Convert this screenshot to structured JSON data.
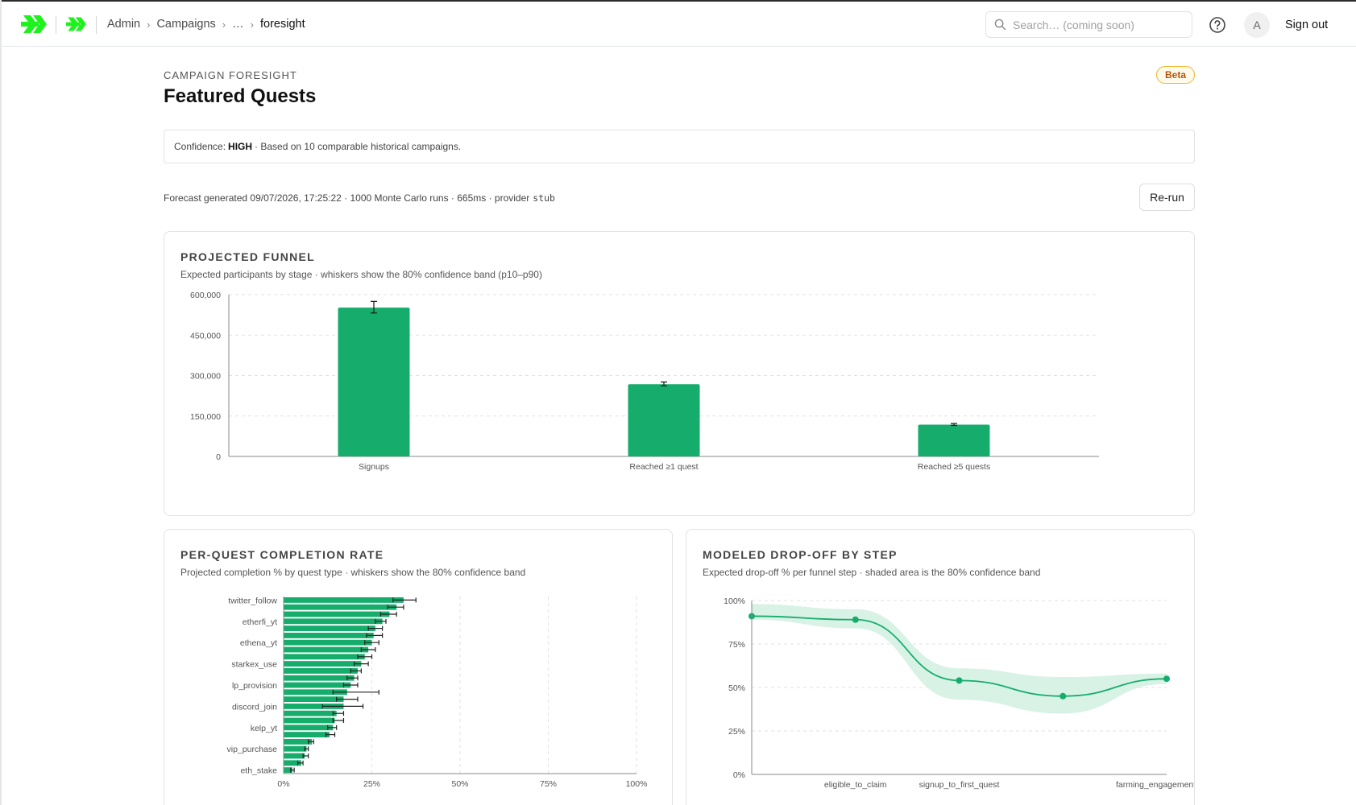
{
  "header": {
    "breadcrumb": [
      "Admin",
      "Campaigns",
      "…",
      "foresight"
    ],
    "search_placeholder": "Search… (coming soon)",
    "avatar_initial": "A",
    "sign_out": "Sign out"
  },
  "page": {
    "eyebrow": "CAMPAIGN FORESIGHT",
    "title": "Featured Quests",
    "badge": "Beta",
    "confidence_label": "Confidence:",
    "confidence_value": "HIGH",
    "confidence_note": "· Based on 10 comparable historical campaigns.",
    "meta_text": "Forecast generated 09/07/2026, 17:25:22 · 1000 Monte Carlo runs · 665ms · provider",
    "provider": "stub",
    "rerun_label": "Re-run"
  },
  "colors": {
    "accent": "#16ad6c",
    "brand_green": "#1df21d",
    "band": "#d8f2e6"
  },
  "cards": {
    "funnel": {
      "title": "PROJECTED FUNNEL",
      "subtitle": "Expected participants by stage · whiskers show the 80% confidence band (p10–p90)"
    },
    "completion": {
      "title": "PER-QUEST COMPLETION RATE",
      "subtitle": "Projected completion % by quest type · whiskers show the 80% confidence band"
    },
    "dropoff": {
      "title": "MODELED DROP-OFF BY STEP",
      "subtitle": "Expected drop-off % per funnel step · shaded area is the 80% confidence band"
    }
  },
  "chart_data": [
    {
      "type": "bar",
      "categories": [
        "Signups",
        "Reached ≥1 quest",
        "Reached ≥5 quests"
      ],
      "values": [
        552000,
        268000,
        118000
      ],
      "p10": [
        532000,
        262000,
        115000
      ],
      "p90": [
        575000,
        276000,
        122000
      ],
      "ylim": [
        0,
        600000
      ],
      "yticks": [
        0,
        150000,
        300000,
        450000,
        600000
      ],
      "ytick_labels": [
        "0",
        "150,000",
        "300,000",
        "450,000",
        "600,000"
      ],
      "grid": true
    },
    {
      "type": "bar",
      "orientation": "horizontal",
      "categories": [
        "twitter_follow",
        "",
        "",
        "etherfi_yt",
        "",
        "",
        "ethena_yt",
        "",
        "",
        "starkex_use",
        "",
        "",
        "lp_provision",
        "",
        "",
        "discord_join",
        "",
        "",
        "kelp_yt",
        "",
        "",
        "vip_purchase",
        "",
        "",
        "eth_stake"
      ],
      "values": [
        34,
        32,
        30,
        28,
        26,
        25.5,
        25,
        24,
        23,
        22,
        21,
        20,
        19,
        18,
        17,
        17,
        15,
        14.5,
        14,
        13,
        8,
        6.5,
        6,
        5,
        2.5
      ],
      "p10": [
        31,
        29.5,
        27.5,
        26,
        24,
        23.5,
        23,
        22,
        21,
        20,
        19,
        18,
        17,
        14,
        15,
        11,
        14,
        14,
        12.5,
        12,
        7,
        6,
        5.5,
        4,
        2
      ],
      "p90": [
        37.5,
        34,
        32,
        29,
        28,
        28,
        27,
        26,
        25,
        24,
        22,
        21,
        21,
        27,
        21,
        22.5,
        17,
        17,
        15,
        14.5,
        8.5,
        7,
        7,
        5.5,
        3
      ],
      "xlim": [
        0,
        100
      ],
      "xticks": [
        0,
        25,
        50,
        75,
        100
      ],
      "xtick_labels": [
        "0%",
        "25%",
        "50%",
        "75%",
        "100%"
      ],
      "grid": true
    },
    {
      "type": "line",
      "x": [
        "",
        "eligible_to_claim",
        "signup_to_first_quest",
        "",
        "farming_engagement_drop"
      ],
      "values": [
        91,
        89,
        54,
        45,
        55
      ],
      "band_low": [
        89,
        84,
        43,
        35,
        52
      ],
      "band_high": [
        98,
        95,
        61,
        56,
        58
      ],
      "ylim": [
        0,
        100
      ],
      "yticks": [
        0,
        25,
        50,
        75,
        100
      ],
      "ytick_labels": [
        "0%",
        "25%",
        "50%",
        "75%",
        "100%"
      ],
      "grid": true
    }
  ]
}
